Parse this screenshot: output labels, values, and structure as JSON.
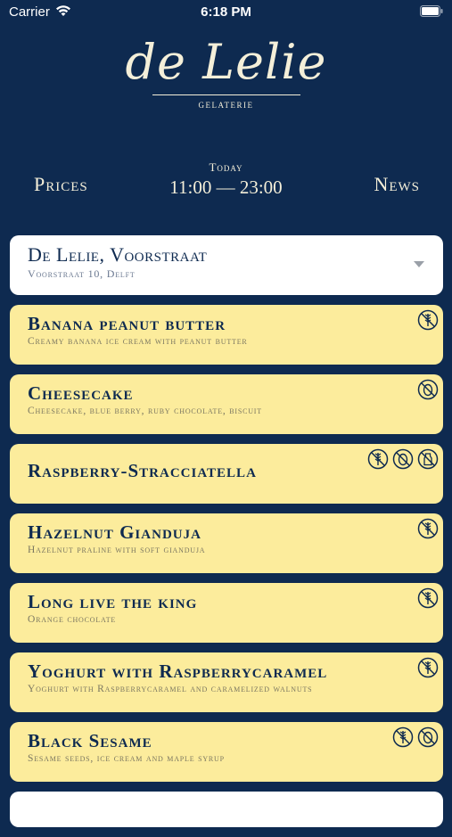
{
  "status_bar": {
    "carrier": "Carrier",
    "time": "6:18 PM"
  },
  "logo": {
    "name": "de Lelie",
    "subtitle": "GELATERIE"
  },
  "header": {
    "prices_label": "Prices",
    "hours_label": "Today",
    "hours_value": "11:00 — 23:00",
    "news_label": "News"
  },
  "location": {
    "name": "De Lelie, Voorstraat",
    "address": "Voorstraat 10, Delft"
  },
  "flavors": [
    {
      "name": "Banana peanut butter",
      "description": "Creamy banana ice cream with peanut butter",
      "icons": [
        "no-gluten-icon"
      ]
    },
    {
      "name": "Cheesecake",
      "description": "Cheesecake, blue berry, ruby chocolate, biscuit",
      "icons": [
        "no-egg-icon"
      ]
    },
    {
      "name": "Raspberry-Stracciatella",
      "description": "",
      "icons": [
        "no-gluten-icon",
        "no-egg-icon",
        "no-dairy-icon"
      ]
    },
    {
      "name": "Hazelnut Gianduja",
      "description": "Hazelnut praline with soft gianduja",
      "icons": [
        "no-gluten-icon"
      ]
    },
    {
      "name": "Long live the king",
      "description": "Orange chocolate",
      "icons": [
        "no-gluten-icon"
      ]
    },
    {
      "name": "Yoghurt with Raspberrycaramel",
      "description": "Yoghurt with Raspberrycaramel and caramelized walnuts",
      "icons": [
        "no-gluten-icon"
      ]
    },
    {
      "name": "Black Sesame",
      "description": "Sesame seeds, ice cream and maple syrup",
      "icons": [
        "no-gluten-icon",
        "no-egg-icon"
      ]
    }
  ],
  "colors": {
    "background": "#0e2a50",
    "card": "#fcec9c",
    "text_light": "#f4efd9"
  }
}
